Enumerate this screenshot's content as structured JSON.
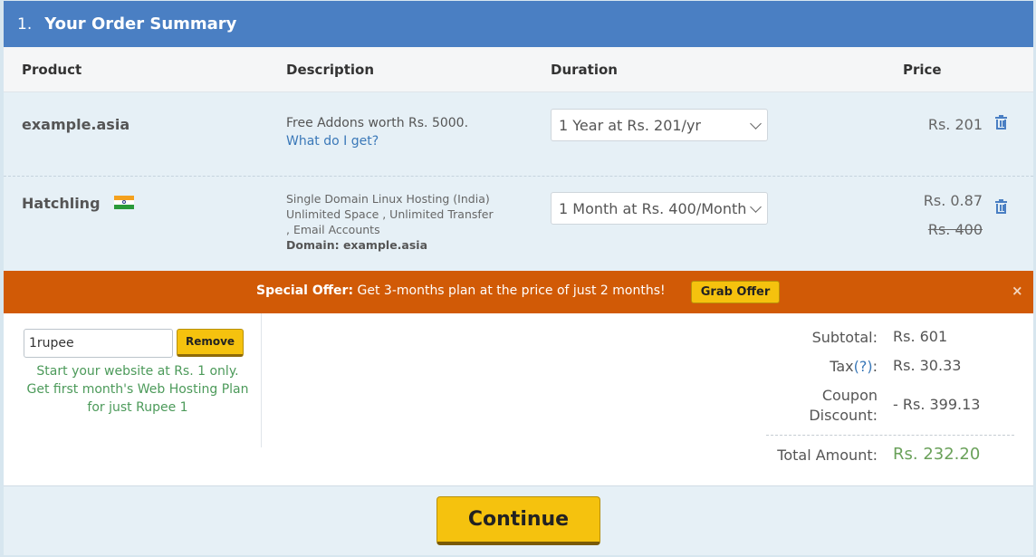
{
  "header": {
    "step_number": "1.",
    "title": "Your Order Summary"
  },
  "columns": {
    "product": "Product",
    "description": "Description",
    "duration": "Duration",
    "price": "Price"
  },
  "items": [
    {
      "product": "example.asia",
      "description_line1": "Free Addons worth Rs. 5000.",
      "description_link": "What do I get?",
      "duration": "1 Year at Rs. 201/yr",
      "price": "Rs. 201"
    },
    {
      "product": "Hatchling",
      "flag_icon": "india-flag-icon",
      "description_lines": [
        "Single Domain Linux Hosting (India)",
        "Unlimited Space , Unlimited Transfer",
        ", Email Accounts"
      ],
      "description_domain": "Domain: example.asia",
      "duration": "1 Month at Rs. 400/Month",
      "price": "Rs. 0.87",
      "original_price": "Rs. 400"
    }
  ],
  "offer": {
    "label": "Special Offer:",
    "text": " Get 3-months plan at the price of just 2 months!",
    "button": "Grab Offer",
    "close": "×"
  },
  "coupon": {
    "value": "1rupee",
    "remove_label": "Remove",
    "message_line1": "Start your website at Rs. 1 only.",
    "message_line2": "Get first month's Web Hosting Plan for just Rupee 1"
  },
  "summary": {
    "subtotal_label": "Subtotal:",
    "subtotal_value": "Rs. 601",
    "tax_label": "Tax",
    "tax_help": "(?)",
    "tax_colon": ":",
    "tax_value": "Rs. 30.33",
    "coupon_label_line1": "Coupon",
    "coupon_label_line2": "Discount:",
    "coupon_value": "- Rs. 399.13",
    "total_label": "Total Amount:",
    "total_value": "Rs. 232.20"
  },
  "footer": {
    "continue_label": "Continue"
  },
  "colors": {
    "header": "#4a7fc3",
    "offer_bar": "#d15a06",
    "button": "#f5c20e",
    "promo_text": "#4c9a5a",
    "total": "#6aa15a"
  }
}
